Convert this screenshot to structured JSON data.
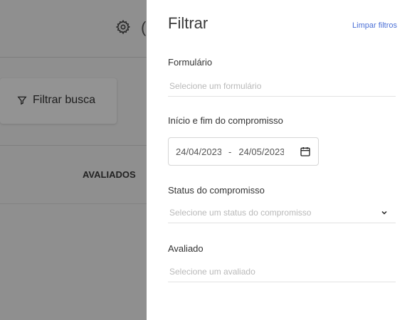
{
  "background": {
    "filter_button_label": "Filtrar busca",
    "column_header": "AVALIADOS"
  },
  "drawer": {
    "title": "Filtrar",
    "clear_filters": "Limpar filtros",
    "form": {
      "label": "Formulário",
      "placeholder": "Selecione um formulário"
    },
    "period": {
      "label": "Início e fim do compromisso",
      "start": "24/04/2023",
      "separator": "-",
      "end": "24/05/2023"
    },
    "status": {
      "label": "Status do compromisso",
      "placeholder": "Selecione um status do compromisso"
    },
    "evaluated": {
      "label": "Avaliado",
      "placeholder": "Selecione um avaliado"
    }
  },
  "colors": {
    "link": "#4a6fd6",
    "overlay": "#8f8f8f"
  }
}
